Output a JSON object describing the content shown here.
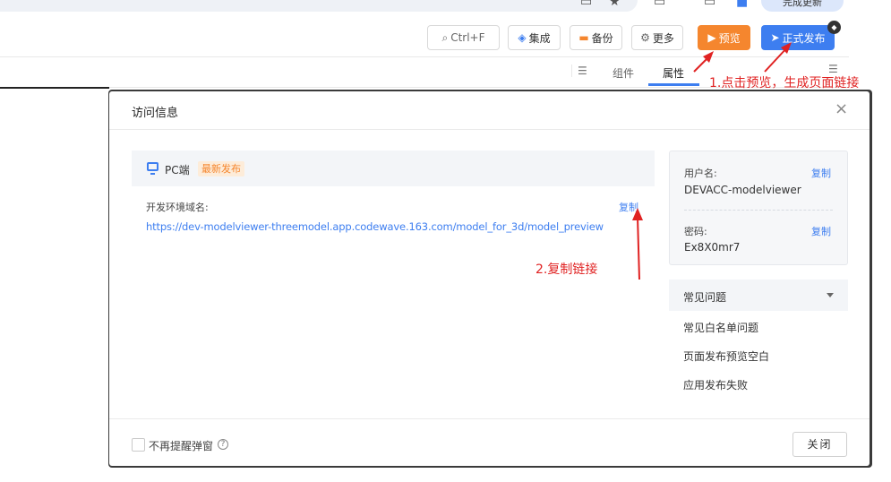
{
  "browser": {
    "update_label": "完成更新",
    "icons": [
      "bookmark-icon",
      "star-icon",
      "window-icon",
      "profile-icon"
    ]
  },
  "toolbar": {
    "search_label": "Ctrl+F",
    "integrate_label": "集成",
    "backup_label": "备份",
    "more_label": "更多",
    "preview_label": "预览",
    "publish_label": "正式发布",
    "colors": {
      "preview": "#f5862e",
      "publish": "#3d7ef0"
    }
  },
  "panel_tabs": {
    "components": "组件",
    "properties": "属性"
  },
  "annotations": {
    "step1": "1.点击预览，生成页面链接",
    "step2": "2.复制链接"
  },
  "dialog": {
    "title": "访问信息",
    "pc": {
      "label": "PC端",
      "badge": "最新发布"
    },
    "domain": {
      "label": "开发环境域名:",
      "copy": "复制",
      "url": "https://dev-modelviewer-threemodel.app.codewave.163.com/model_for_3d/model_preview"
    },
    "credentials": {
      "username_label": "用户名:",
      "username_copy": "复制",
      "username": "DEVACC-modelviewer",
      "password_label": "密码:",
      "password_copy": "复制",
      "password": "Ex8X0mr7"
    },
    "faq": {
      "title": "常见问题",
      "items": [
        "常见白名单问题",
        "页面发布预览空白",
        "应用发布失败"
      ]
    },
    "footer": {
      "dont_remind": "不再提醒弹窗",
      "close": "关闭"
    }
  }
}
